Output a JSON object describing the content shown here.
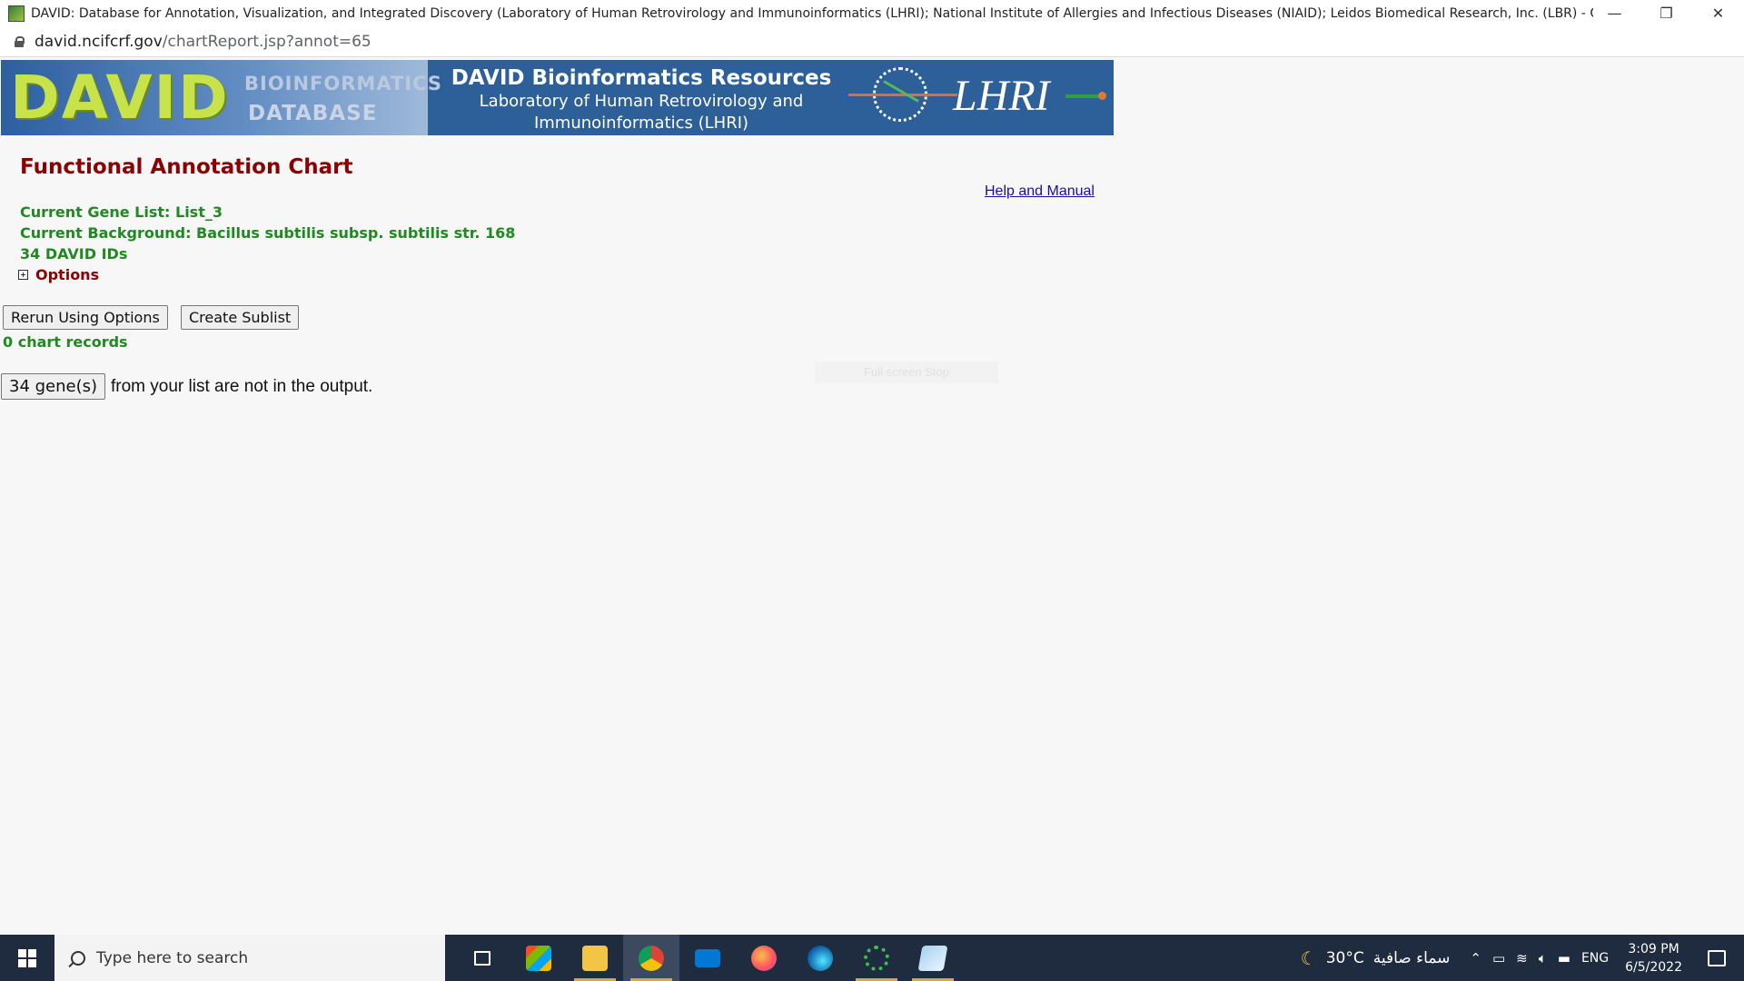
{
  "window": {
    "title": "DAVID: Database for Annotation, Visualization, and Integrated Discovery (Laboratory of Human Retrovirology and Immunoinformatics (LHRI); National Institute of Allergies and Infectious Diseases (NIAID); Leidos Biomedical Research, Inc. (LBR) - Google Chrome",
    "minimize": "—",
    "restore": "❐",
    "close": "✕"
  },
  "address": {
    "host": "david.ncifcrf.gov",
    "path": "/chartReport.jsp?annot=65"
  },
  "banner": {
    "logo": "DAVID",
    "logo_sub1": "BIOINFORMATICS",
    "logo_sub2": "DATABASE",
    "title": "DAVID Bioinformatics Resources",
    "subtitle_line1": "Laboratory of Human Retrovirology and",
    "subtitle_line2": "Immunoinformatics (LHRI)",
    "lhri": "LHRI"
  },
  "main": {
    "heading": "Functional Annotation Chart",
    "help_link": "Help and Manual",
    "gene_list": "Current Gene List: List_3",
    "background": "Current Background: Bacillus subtilis subsp. subtilis str. 168",
    "ids": "34 DAVID IDs",
    "options": "Options",
    "rerun_button": "Rerun Using Options",
    "sublist_button": "Create Sublist",
    "records": "0 chart records",
    "genes_button": "34 gene(s)",
    "genes_text": "from your list are not in the output.",
    "ghost_text": "Full screen Stop"
  },
  "taskbar": {
    "search_placeholder": "Type here to search",
    "apps": [
      "task-view",
      "microsoft-store",
      "file-explorer",
      "chrome",
      "mail",
      "firefox",
      "edge",
      "app-green",
      "app-notes"
    ],
    "temperature": "30°C",
    "weather": "سماء صافية",
    "language": "ENG",
    "time": "3:09 PM",
    "date": "6/5/2022"
  },
  "colors": {
    "heading": "#8b0000",
    "info_green": "#1f8a1f",
    "banner_blue": "#2d5f99",
    "taskbar": "#1f2c3f"
  }
}
